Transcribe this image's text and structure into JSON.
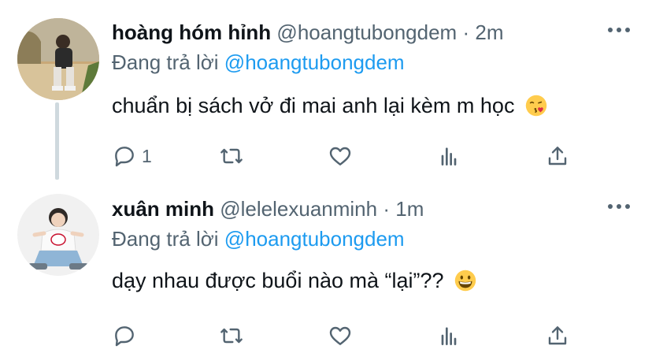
{
  "tweets": [
    {
      "display_name": "hoàng hóm hỉnh",
      "handle": "@hoangtubongdem",
      "separator": "·",
      "time": "2m",
      "reply_prefix": "Đang trả lời",
      "reply_to": "@hoangtubongdem",
      "text": "chuẩn bị sách vở đi mai anh lại kèm m học",
      "emoji": "face-blowing-kiss-emoji",
      "reply_count": "1"
    },
    {
      "display_name": "xuân minh",
      "handle": "@lelelexuanminh",
      "separator": "·",
      "time": "1m",
      "reply_prefix": "Đang trả lời",
      "reply_to": "@hoangtubongdem",
      "text": "dạy nhau được buổi nào mà “lại”??",
      "emoji": "grinning-face-emoji",
      "reply_count": ""
    }
  ],
  "colors": {
    "text": "#0f1419",
    "secondary": "#536471",
    "link": "#1d9bf0",
    "thread_line": "#cfd9de",
    "background": "#ffffff"
  },
  "icons": [
    "more-icon",
    "reply-icon",
    "retweet-icon",
    "like-icon",
    "analytics-icon",
    "share-icon"
  ]
}
